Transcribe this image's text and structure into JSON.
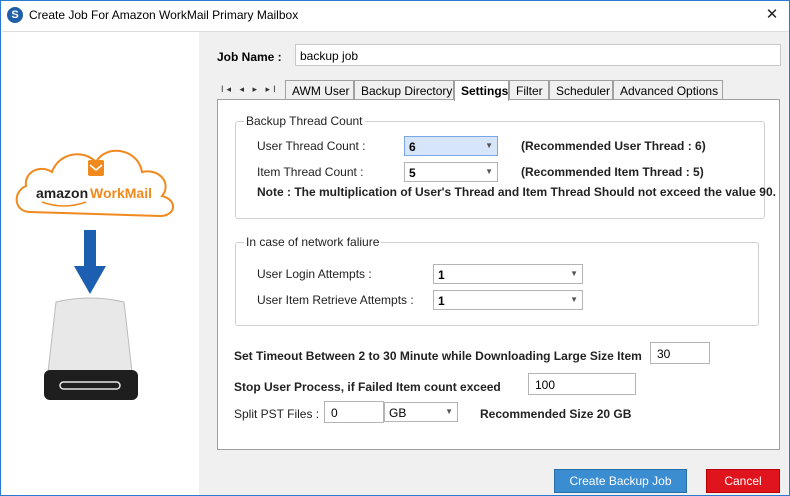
{
  "window": {
    "title": "Create Job For Amazon WorkMail Primary Mailbox",
    "app_icon_letter": "S",
    "close_glyph": "✕"
  },
  "left_panel": {
    "logo_brand": "amazon",
    "logo_product": "WorkMail",
    "icons": [
      "cloud-icon",
      "arrow-down-icon",
      "hard-drive-icon"
    ]
  },
  "job": {
    "label": "Job Name :",
    "value": "backup job"
  },
  "tab_nav": {
    "glyphs": "I◂ ◂ ▸ ▸I"
  },
  "tabs": [
    {
      "label": "AWM User",
      "active": false
    },
    {
      "label": "Backup Directory",
      "active": false
    },
    {
      "label": "Settings",
      "active": true
    },
    {
      "label": "Filter",
      "active": false
    },
    {
      "label": "Scheduler",
      "active": false
    },
    {
      "label": "Advanced Options",
      "active": false
    }
  ],
  "settings": {
    "backup_thread": {
      "title": "Backup Thread Count",
      "user_thread_label": "User Thread Count :",
      "user_thread_value": "6",
      "user_thread_rec": "(Recommended User Thread : 6)",
      "item_thread_label": "Item Thread Count :",
      "item_thread_value": "5",
      "item_thread_rec": "(Recommended Item Thread : 5)",
      "note": "Note : The multiplication of User's Thread and Item Thread Should not exceed the value 90."
    },
    "network": {
      "title": "In case of network faliure",
      "login_label": "User Login Attempts :",
      "login_value": "1",
      "retrieve_label": "User Item Retrieve Attempts :",
      "retrieve_value": "1"
    },
    "timeout_label": "Set Timeout Between 2 to 30 Minute while Downloading Large Size Item",
    "timeout_value": "30",
    "stop_label": "Stop User Process, if Failed Item count exceed",
    "stop_value": "100",
    "split_label": "Split PST Files :",
    "split_value": "0",
    "split_unit": "GB",
    "split_rec": "Recommended Size 20 GB"
  },
  "buttons": {
    "create": "Create Backup Job",
    "cancel": "Cancel"
  },
  "colors": {
    "accent_blue": "#3a8dd0",
    "cancel_red": "#e0141c",
    "brand_orange": "#f0891e"
  }
}
